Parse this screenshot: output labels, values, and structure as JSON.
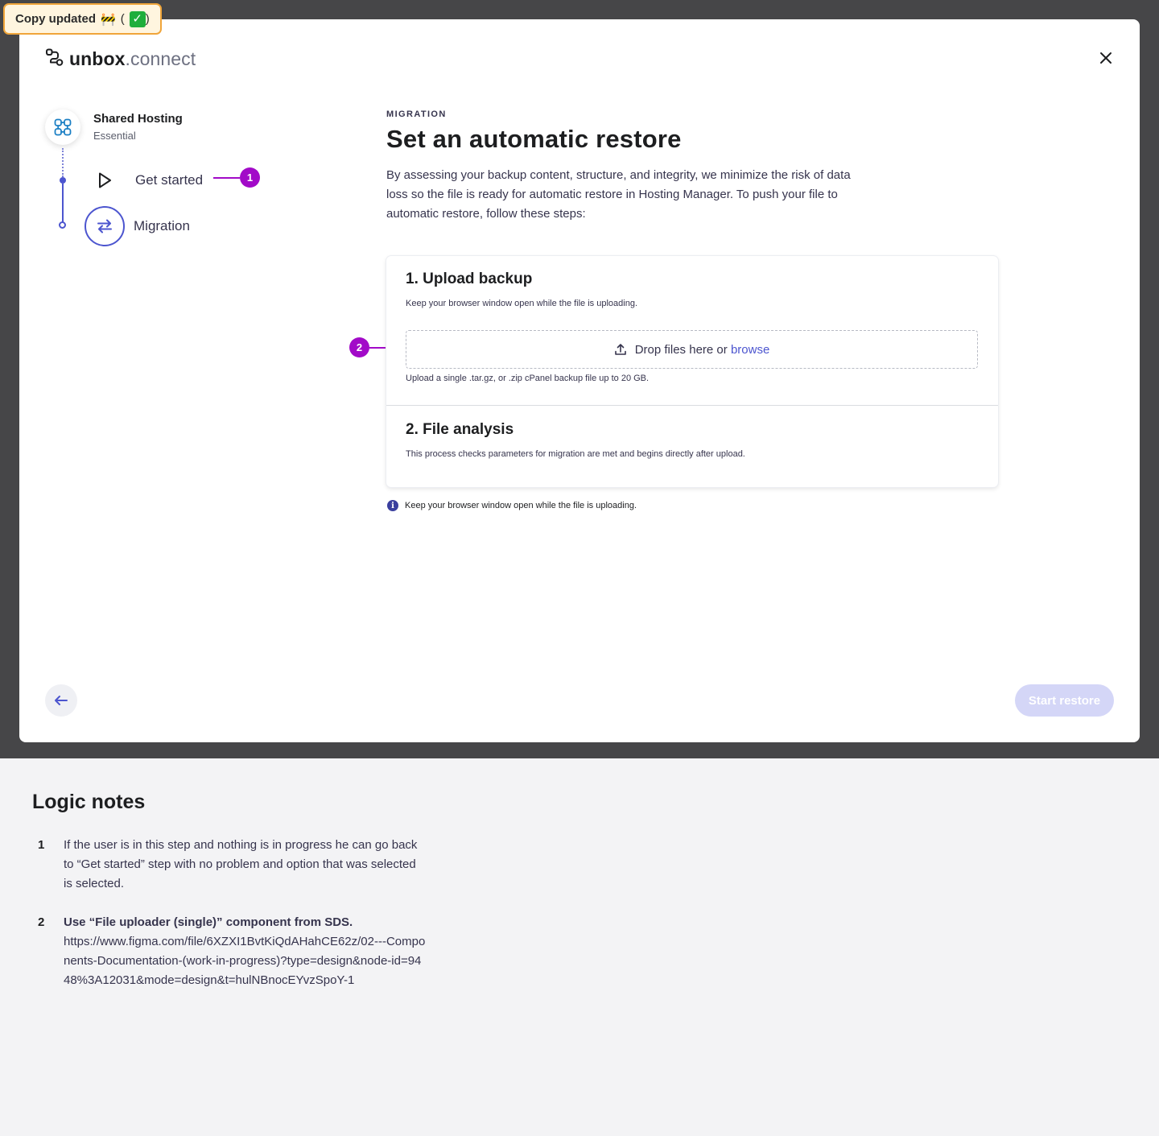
{
  "badge": {
    "label": "Copy updated",
    "emoji": "🚧",
    "open_paren": "(",
    "check": "✓",
    "close_paren": ")"
  },
  "logo": {
    "bold": "unbox",
    "light": ".connect"
  },
  "stepper": {
    "product_name": "Shared Hosting",
    "product_plan": "Essential",
    "steps": [
      {
        "label": "Get started",
        "icon": "play-icon",
        "state": "completed"
      },
      {
        "label": "Migration",
        "icon": "swap-arrows-icon",
        "state": "current"
      }
    ]
  },
  "annotations": [
    "1",
    "2"
  ],
  "content": {
    "kicker": "MIGRATION",
    "title": "Set an automatic restore",
    "description": "By assessing your backup content, structure, and integrity, we minimize the risk of data loss so the file is ready for automatic restore in Hosting Manager. To push your file to automatic restore, follow these steps:"
  },
  "card": {
    "upload": {
      "title": "1. Upload backup",
      "subtitle": "Keep your browser window open while the file is uploading.",
      "drop_text": "Drop files here or",
      "browse_link": "browse",
      "hint": "Upload a single .tar.gz, or .zip cPanel backup file up to 20 GB."
    },
    "analysis": {
      "title": "2. File analysis",
      "subtitle": "This process checks parameters for migration are met and begins directly after upload."
    }
  },
  "info": {
    "text": "Keep your browser window open while the file is uploading."
  },
  "footer": {
    "start_label": "Start restore",
    "start_enabled": false
  },
  "notes": {
    "title": "Logic notes",
    "items": [
      {
        "num": "1",
        "strong": "",
        "text": "If the user is in this step and nothing is in progress he can go back to “Get started” step with no problem and option that was selected is selected."
      },
      {
        "num": "2",
        "strong": "Use “File uploader (single)” component from SDS.",
        "text": "https://www.figma.com/file/6XZXI1BvtKiQdAHahCE62z/02---Components-Documentation-(work-in-progress)?type=design&node-id=9448%3A12031&mode=design&t=hulNBnocEYvzSpoY-1"
      }
    ]
  },
  "colors": {
    "primary": "#4c55cf",
    "annotation": "#a20ac8",
    "dark_band": "#464648",
    "disabled_button": "#d4d6f7"
  }
}
